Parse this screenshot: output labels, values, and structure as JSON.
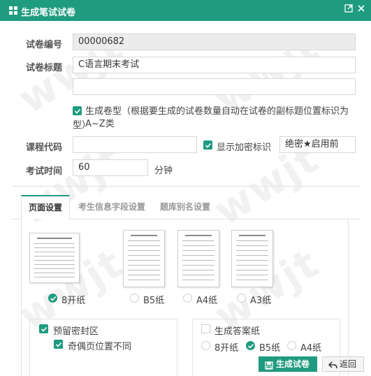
{
  "window": {
    "title": "生成笔试试卷"
  },
  "form": {
    "paper_no_label": "试卷编号",
    "paper_no_value": "00000682",
    "paper_title_label": "试卷标题",
    "paper_title_value": "C语言期末考试",
    "paper_subtitle_value": "",
    "gen_type_label": "生成卷型",
    "gen_type_desc_1": "（根据要生成的试卷数量自动在试卷的副标题位置标识为A~Z类",
    "gen_type_desc_2": "型）",
    "course_code_label": "课程代码",
    "course_code_value": "",
    "show_secret_label": "显示加密标识",
    "secret_value": "绝密★启用前",
    "exam_time_label": "考试时间",
    "exam_time_value": "60",
    "exam_time_unit": "分钟"
  },
  "tabs": [
    {
      "label": "页面设置",
      "active": true
    },
    {
      "label": "考生信息字段设置",
      "active": false
    },
    {
      "label": "题库别名设置",
      "active": false
    }
  ],
  "paper_sizes": [
    {
      "label": "8开纸",
      "selected": true
    },
    {
      "label": "B5纸",
      "selected": false
    },
    {
      "label": "A4纸",
      "selected": false
    },
    {
      "label": "A3纸",
      "selected": false
    }
  ],
  "seal": {
    "reserve_label": "预留密封区",
    "reserve_checked": true,
    "odd_even_label": "奇偶页位置不同",
    "odd_even_checked": true
  },
  "answer": {
    "gen_answer_label": "生成答案纸",
    "gen_answer_checked": false,
    "sizes": [
      {
        "label": "8开纸",
        "selected": false
      },
      {
        "label": "B5纸",
        "selected": true
      },
      {
        "label": "A4纸",
        "selected": false
      }
    ]
  },
  "buttons": {
    "generate": "生成试卷",
    "back": "返回"
  },
  "watermark": {
    "text": "wwjt"
  },
  "colors": {
    "primary": "#1f9b7f",
    "border": "#e2e2e2"
  }
}
